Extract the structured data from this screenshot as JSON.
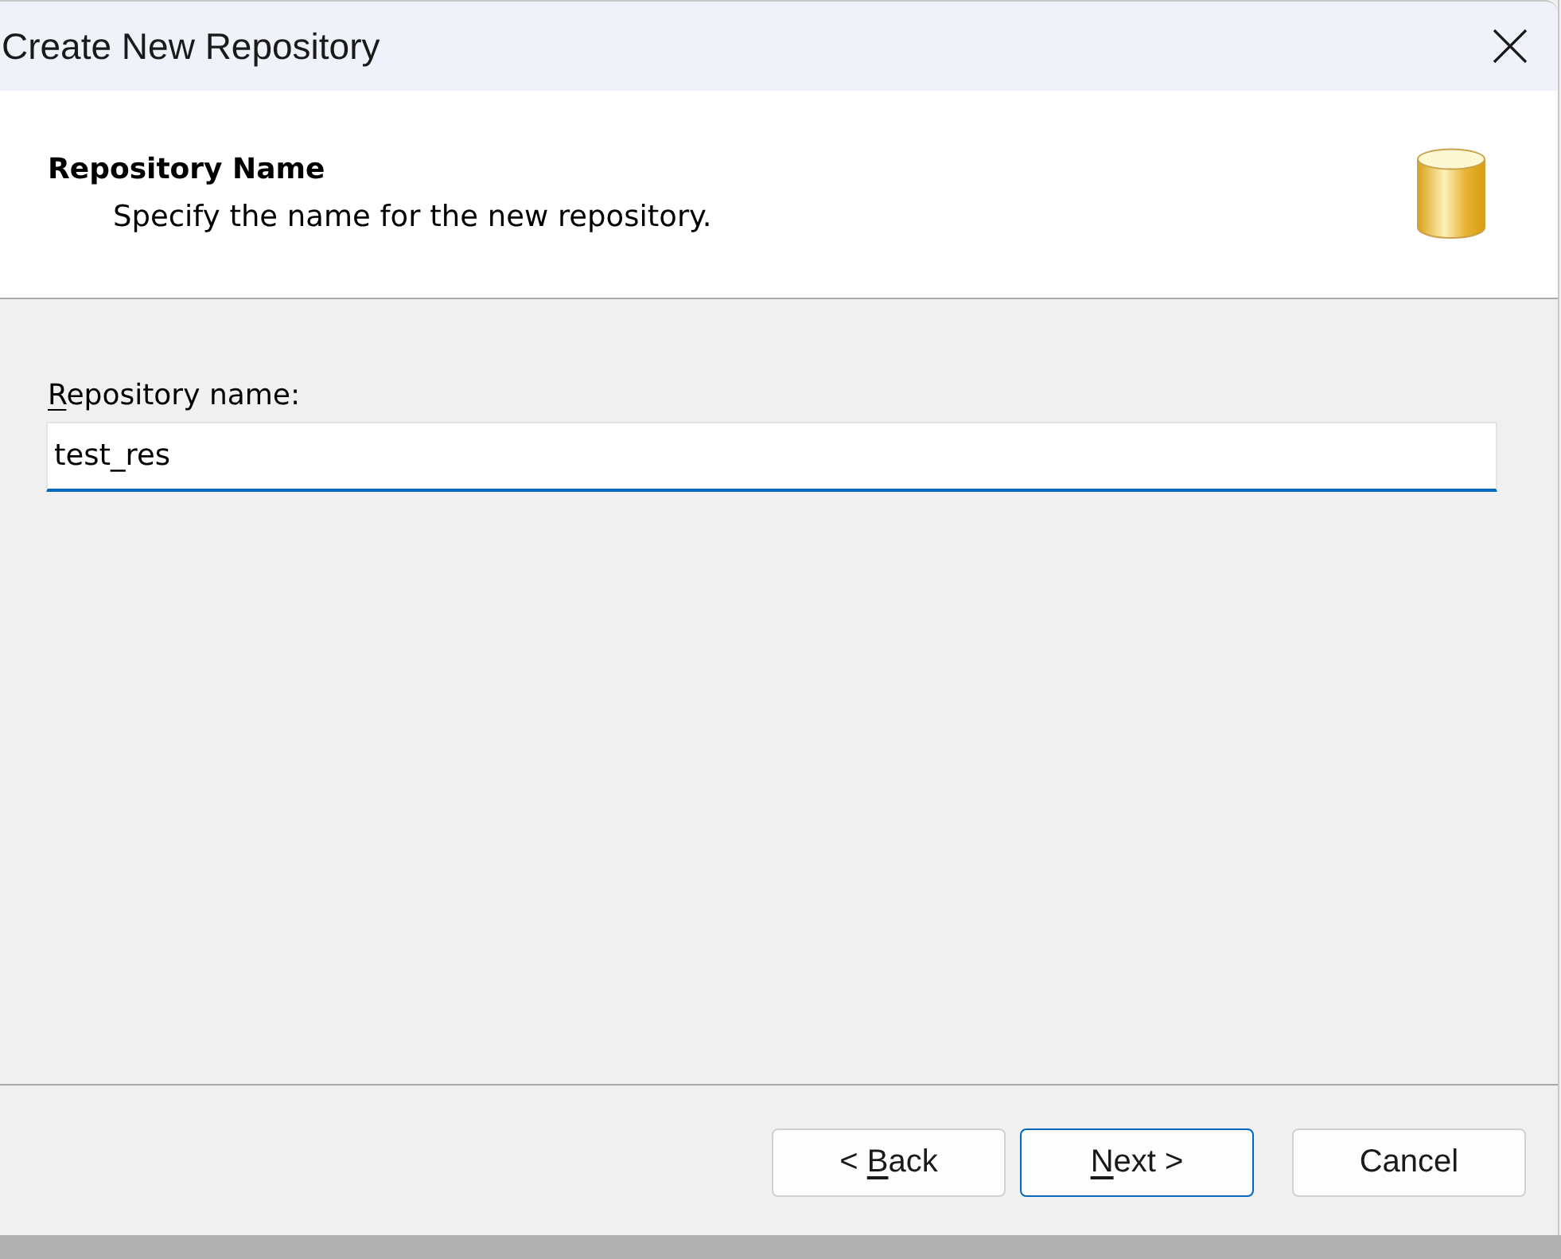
{
  "window": {
    "title": "Create New Repository"
  },
  "header": {
    "title": "Repository Name",
    "subtitle": "Specify the name for the new repository."
  },
  "form": {
    "label": [
      {
        "text": "R",
        "underlined": true
      },
      {
        "text": "epository name:",
        "underlined": false
      }
    ],
    "field": {
      "value": "test_res",
      "focused": true
    }
  },
  "buttons": [
    {
      "label": [
        {
          "text": "< ",
          "underlined": false
        },
        {
          "text": "B",
          "underlined": true
        },
        {
          "text": "ack",
          "underlined": false
        }
      ],
      "focused": false
    },
    {
      "label": [
        {
          "text": "N",
          "underlined": true
        },
        {
          "text": "ext >",
          "underlined": false
        }
      ],
      "focused": true
    },
    {
      "label": [
        {
          "text": "Cancel",
          "underlined": false
        }
      ],
      "focused": false
    }
  ]
}
